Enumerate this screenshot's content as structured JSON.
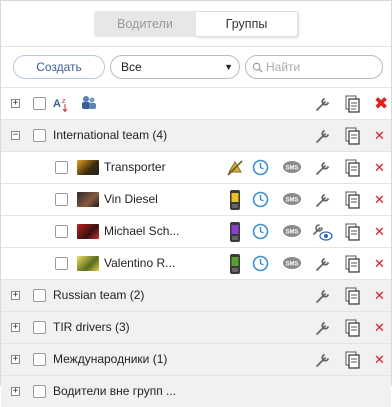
{
  "tabs": {
    "drivers": "Водители",
    "groups": "Группы"
  },
  "toolbar": {
    "create_label": "Создать",
    "select_value": "Все",
    "search_placeholder": "Найти"
  },
  "groups": [
    {
      "name": "International team (4)",
      "expanded": true
    },
    {
      "name": "Russian team (2)",
      "expanded": false
    },
    {
      "name": "TIR drivers (3)",
      "expanded": false
    },
    {
      "name": "Международники (1)",
      "expanded": false
    },
    {
      "name": "Водители вне групп ...",
      "expanded": false
    }
  ],
  "drivers": [
    {
      "name": "Transporter",
      "phone_color": ""
    },
    {
      "name": "Vin Diesel",
      "phone_color": "#e8c020"
    },
    {
      "name": "Michael Sch...",
      "phone_color": "#8a3fd0"
    },
    {
      "name": "Valentino R...",
      "phone_color": "#5aa030"
    }
  ],
  "colors": {
    "accent": "#3a5f96",
    "close": "#e02020",
    "clock": "#3d8ed8"
  }
}
